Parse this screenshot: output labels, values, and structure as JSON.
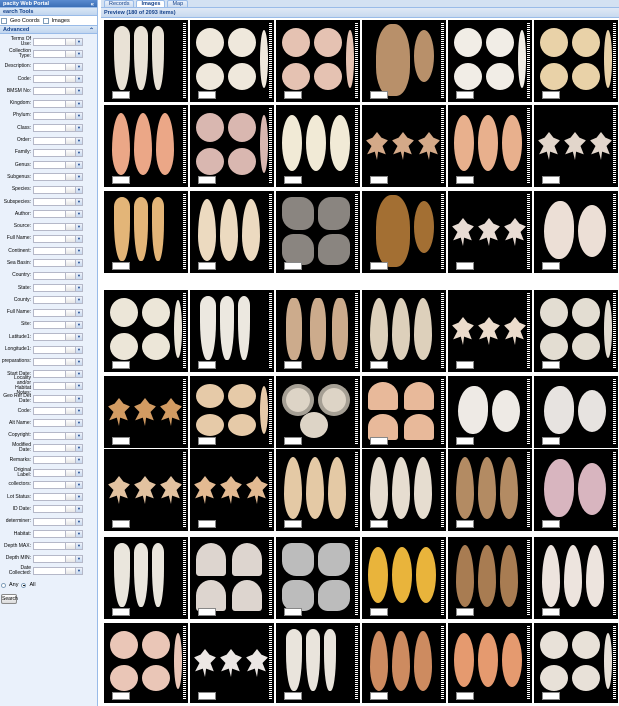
{
  "left_panel": {
    "title": "pacity Web Portal",
    "search_tools_title": "earch Tools",
    "geo_coords_label": "Geo Coords",
    "images_label": "Images",
    "advanced_title": "Advanced",
    "fields": [
      "Terms Of Use:",
      "Collection Type:",
      "Description:",
      "Code:",
      "BMSM No:",
      "Kingdom:",
      "Phylum:",
      "Class:",
      "Order:",
      "Family:",
      "Genus:",
      "Subgenus:",
      "Species:",
      "Subspecies:",
      "Author:",
      "Source:",
      "Full Name:",
      "Continent:",
      "Sea Basin:",
      "Country:",
      "State:",
      "County:",
      "Full Name:",
      "Site:",
      "Latitude1:",
      "Longitude1:",
      "preparations:",
      "Start Date:",
      "Locality and/or Habitat Notes:",
      "Geo Ref Det Date:",
      "Code:",
      "Alt Name:",
      "Copyright:",
      "Modified Date:",
      "Remarks:",
      "Original Label:",
      "collectors:",
      "Lot Status:",
      "ID Date:",
      "determiner:",
      "Habitat:",
      "Depth MAX:",
      "Depth MIN:",
      "Date Collected:"
    ],
    "match_any": "Any",
    "match_all": "All",
    "search_button": "Search"
  },
  "tabs": [
    "Records",
    "Images",
    "Map"
  ],
  "active_tab": "Images",
  "preview_title": "Preview (180 of 2093 items)",
  "colors": {
    "panel_border": "#99bbe8",
    "header_text": "#15428b",
    "photo_background": "#000000"
  },
  "thumbnails": [
    {
      "kind": "spires",
      "color": "#e9e2d6"
    },
    {
      "kind": "clams",
      "color": "#efe8dc"
    },
    {
      "kind": "clams",
      "color": "#e5c2b2"
    },
    {
      "kind": "mussel",
      "color": "#b8906a"
    },
    {
      "kind": "clams",
      "color": "#f1ede6"
    },
    {
      "kind": "clams",
      "color": "#e9d2a8"
    },
    {
      "kind": "cones",
      "color": "#eba787"
    },
    {
      "kind": "clams",
      "color": "#d9b7b0"
    },
    {
      "kind": "cowries",
      "color": "#f1ead6"
    },
    {
      "kind": "murex",
      "color": "#d4a988"
    },
    {
      "kind": "cowries",
      "color": "#e8b08d"
    },
    {
      "kind": "murex",
      "color": "#e2d6cb"
    },
    {
      "kind": "spires",
      "color": "#e3b578"
    },
    {
      "kind": "cones",
      "color": "#ecdac0"
    },
    {
      "kind": "oysters",
      "color": "#8a8580"
    },
    {
      "kind": "mussel",
      "color": "#a36f33"
    },
    {
      "kind": "murex",
      "color": "#e9dcd4"
    },
    {
      "kind": "snails",
      "color": "#ecdfd6"
    },
    {
      "kind": "clams",
      "color": "#ece6d8"
    },
    {
      "kind": "spires",
      "color": "#ece8e0"
    },
    {
      "kind": "spindles",
      "color": "#ccab8c"
    },
    {
      "kind": "cones",
      "color": "#ddd0bb"
    },
    {
      "kind": "murex",
      "color": "#ecdccc"
    },
    {
      "kind": "clams",
      "color": "#e3ddd2"
    },
    {
      "kind": "murex",
      "color": "#d29b62"
    },
    {
      "kind": "clams",
      "color": "#e6caa8"
    },
    {
      "kind": "ammonites",
      "color": "#ddd4c6"
    },
    {
      "kind": "scallops",
      "color": "#e8b99a"
    },
    {
      "kind": "snails",
      "color": "#eeeae5"
    },
    {
      "kind": "snails",
      "color": "#e7e3e0"
    },
    {
      "kind": "murex",
      "color": "#e2c2a0"
    },
    {
      "kind": "murex",
      "color": "#e3ba92"
    },
    {
      "kind": "cones",
      "color": "#e4c9a5"
    },
    {
      "kind": "cones",
      "color": "#e6ddd0"
    },
    {
      "kind": "cones",
      "color": "#b38b63"
    },
    {
      "kind": "snails",
      "color": "#d8b5bf"
    },
    {
      "kind": "spires",
      "color": "#eae6dd"
    },
    {
      "kind": "scallops",
      "color": "#ddd5cf"
    },
    {
      "kind": "oysters",
      "color": "#bcbcbc"
    },
    {
      "kind": "cowries",
      "color": "#e9b43b"
    },
    {
      "kind": "cones",
      "color": "#a87c52"
    },
    {
      "kind": "cones",
      "color": "#ede4de"
    },
    {
      "kind": "clams",
      "color": "#eac6b7"
    },
    {
      "kind": "murex",
      "color": "#ece7e4"
    },
    {
      "kind": "spires",
      "color": "#e9e4dc"
    },
    {
      "kind": "cones",
      "color": "#cd8b60"
    },
    {
      "kind": "cowries",
      "color": "#e59a6f"
    },
    {
      "kind": "clams",
      "color": "#e8e1d8"
    }
  ]
}
